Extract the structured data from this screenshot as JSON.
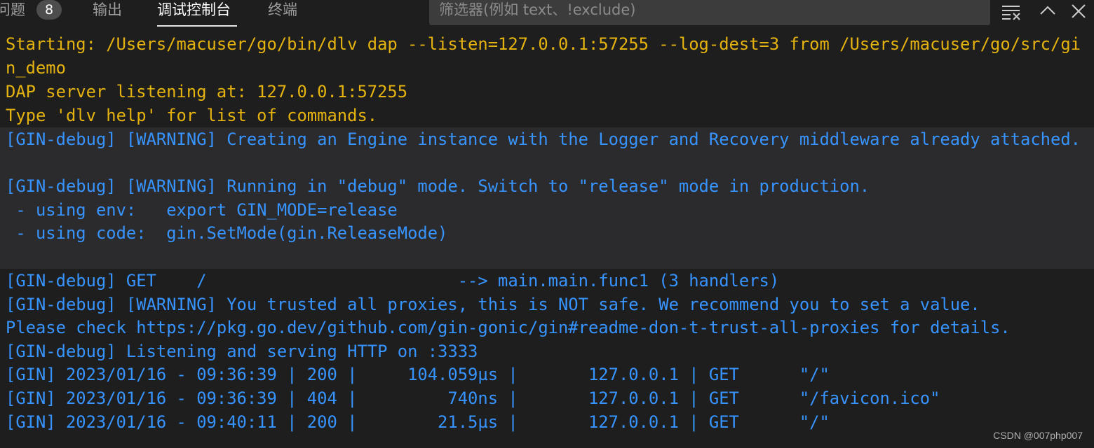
{
  "panel": {
    "tabs": [
      {
        "label": "问题",
        "badge": "8",
        "active": false
      },
      {
        "label": "输出",
        "active": false
      },
      {
        "label": "调试控制台",
        "active": true
      },
      {
        "label": "终端",
        "active": false
      }
    ],
    "filter_placeholder": "筛选器(例如 text、!exclude)",
    "icons": [
      "clear-console-icon",
      "chevron-up-icon",
      "close-icon"
    ]
  },
  "console": {
    "lines": [
      {
        "text": "Starting: /Users/macuser/go/bin/dlv dap --listen=127.0.0.1:57255 --log-dest=3 from /Users/macuser/go/src/gi",
        "color": "#e5b310"
      },
      {
        "text": "n_demo",
        "color": "#e5b310"
      },
      {
        "text": "DAP server listening at: 127.0.0.1:57255",
        "color": "#e5b310"
      },
      {
        "text": "Type 'dlv help' for list of commands.",
        "color": "#e5b310"
      },
      {
        "text": "[GIN-debug] [WARNING] Creating an Engine instance with the Logger and Recovery middleware already attached.",
        "color": "#3794ff"
      },
      {
        "text": "",
        "color": "#3794ff"
      },
      {
        "text": "[GIN-debug] [WARNING] Running in \"debug\" mode. Switch to \"release\" mode in production.",
        "color": "#3794ff"
      },
      {
        "text": " - using env:   export GIN_MODE=release",
        "color": "#3794ff"
      },
      {
        "text": " - using code:  gin.SetMode(gin.ReleaseMode)",
        "color": "#3794ff"
      },
      {
        "text": "",
        "color": "#3794ff"
      },
      {
        "text": "[GIN-debug] GET    /                         --> main.main.func1 (3 handlers)",
        "color": "#3794ff"
      },
      {
        "text": "[GIN-debug] [WARNING] You trusted all proxies, this is NOT safe. We recommend you to set a value.",
        "color": "#3794ff"
      },
      {
        "text": "Please check https://pkg.go.dev/github.com/gin-gonic/gin#readme-don-t-trust-all-proxies for details.",
        "color": "#3794ff"
      },
      {
        "text": "[GIN-debug] Listening and serving HTTP on :3333",
        "color": "#3794ff"
      },
      {
        "text": "[GIN] 2023/01/16 - 09:36:39 | 200 |     104.059µs |       127.0.0.1 | GET      \"/\"",
        "color": "#3794ff"
      },
      {
        "text": "[GIN] 2023/01/16 - 09:36:39 | 404 |         740ns |       127.0.0.1 | GET      \"/favicon.ico\"",
        "color": "#3794ff"
      },
      {
        "text": "[GIN] 2023/01/16 - 09:40:11 | 200 |        21.5µs |       127.0.0.1 | GET      \"/\"",
        "color": "#3794ff"
      }
    ]
  },
  "watermark": "CSDN @007php007",
  "colors": {
    "background": "#1e1e1e",
    "highlight_band": "#2b2b2d",
    "debugger_text": "#e5b310",
    "program_output": "#3794ff"
  }
}
